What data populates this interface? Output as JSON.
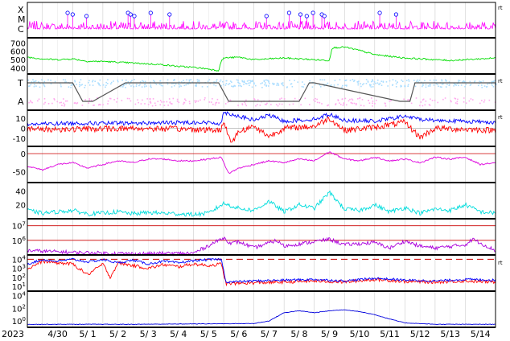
{
  "year": "2023",
  "x_axis": {
    "start": "2023-04-29T12:00",
    "end": "2023-05-15T00:00",
    "tick_labels": [
      {
        "label": "4/30",
        "date": "2023-04-30"
      },
      {
        "label": "5/ 1",
        "date": "2023-05-01"
      },
      {
        "label": "5/ 2",
        "date": "2023-05-02"
      },
      {
        "label": "5/ 3",
        "date": "2023-05-03"
      },
      {
        "label": "5/ 4",
        "date": "2023-05-04"
      },
      {
        "label": "5/ 5",
        "date": "2023-05-05"
      },
      {
        "label": "5/ 6",
        "date": "2023-05-06"
      },
      {
        "label": "5/ 7",
        "date": "2023-05-07"
      },
      {
        "label": "5/ 8",
        "date": "2023-05-08"
      },
      {
        "label": "5/ 9",
        "date": "2023-05-09"
      },
      {
        "label": "5/10",
        "date": "2023-05-10"
      },
      {
        "label": "5/11",
        "date": "2023-05-11"
      },
      {
        "label": "5/12",
        "date": "2023-05-12"
      },
      {
        "label": "5/13",
        "date": "2023-05-13"
      },
      {
        "label": "5/14",
        "date": "2023-05-14"
      }
    ]
  },
  "right_marks": [
    "rt",
    "rt",
    "rt",
    "rt"
  ],
  "colors": {
    "flare": "#ff00ff",
    "flare_marker": "#0000ff",
    "speed": "#00dd00",
    "direction": "#aaddff",
    "direction_away": "#ffaaee",
    "direction_sector": "#555555",
    "b_total": "#0000ff",
    "bz": "#ff0000",
    "dst": "#dd00dd",
    "kp": "#00dddd",
    "electron": "#aa00dd",
    "proton_hi": "#0000ff",
    "proton_lo": "#ff0000",
    "neutron": "#0000dd",
    "ref_line": "#cc0000",
    "grid": "#cccccc"
  },
  "chart_data": [
    {
      "type": "line",
      "panel": "flare",
      "ytick_labels": [
        "X",
        "M",
        "C"
      ],
      "markers": [
        "2023-04-30T20:00",
        "2023-05-01T00:00",
        "2023-05-01T11:00",
        "2023-05-02T20:00",
        "2023-05-02T22:00",
        "2023-05-03T01:00",
        "2023-05-03T14:00",
        "2023-05-04T05:00",
        "2023-05-07T10:00",
        "2023-05-08T04:00",
        "2023-05-08T13:00",
        "2023-05-08T18:00",
        "2023-05-08T23:00",
        "2023-05-09T06:00",
        "2023-05-09T08:00",
        "2023-05-11T04:00",
        "2023-05-11T17:00"
      ]
    },
    {
      "type": "line",
      "panel": "solar-wind-speed",
      "ytick_labels": [
        "700",
        "600",
        "500",
        "400"
      ],
      "ylim": [
        330,
        760
      ],
      "series": [
        {
          "x": [
            "2023-04-29T12:00",
            "2023-04-30T00:00",
            "2023-04-30T12:00",
            "2023-05-01T00:00",
            "2023-05-01T12:00",
            "2023-05-02T00:00",
            "2023-05-02T12:00",
            "2023-05-03T00:00",
            "2023-05-03T12:00",
            "2023-05-04T00:00",
            "2023-05-04T12:00",
            "2023-05-05T00:00",
            "2023-05-05T12:00",
            "2023-05-05T20:00",
            "2023-05-05T22:00",
            "2023-05-06T00:00",
            "2023-05-06T12:00",
            "2023-05-07T00:00",
            "2023-05-07T12:00",
            "2023-05-08T00:00",
            "2023-05-08T12:00",
            "2023-05-09T00:00",
            "2023-05-09T12:00",
            "2023-05-09T14:00",
            "2023-05-10T00:00",
            "2023-05-10T12:00",
            "2023-05-11T00:00",
            "2023-05-11T12:00",
            "2023-05-12T00:00",
            "2023-05-12T12:00",
            "2023-05-13T00:00",
            "2023-05-13T12:00",
            "2023-05-14T00:00",
            "2023-05-14T12:00",
            "2023-05-15T00:00"
          ],
          "values": [
            530,
            510,
            500,
            510,
            480,
            480,
            470,
            460,
            450,
            440,
            420,
            410,
            390,
            370,
            480,
            520,
            530,
            500,
            510,
            520,
            510,
            500,
            490,
            640,
            650,
            610,
            560,
            540,
            520,
            510,
            500,
            490,
            500,
            510,
            520
          ]
        }
      ]
    },
    {
      "type": "scatter",
      "panel": "imf-direction",
      "ytick_labels": [
        "T",
        "A"
      ],
      "sector_x": [
        "2023-04-29T12:00",
        "2023-05-01T00:00",
        "2023-05-01T08:00",
        "2023-05-01T16:00",
        "2023-05-02T18:00",
        "2023-05-03T04:00",
        "2023-05-05T20:00",
        "2023-05-06T04:00",
        "2023-05-08T12:00",
        "2023-05-08T20:00",
        "2023-05-09T00:00",
        "2023-05-11T20:00",
        "2023-05-12T04:00",
        "2023-05-12T08:00",
        "2023-05-15T00:00"
      ],
      "sector_values": [
        "T",
        "T",
        "A",
        "A",
        "T",
        "T",
        "T",
        "A",
        "A",
        "T",
        "T",
        "A",
        "A",
        "T",
        "T"
      ]
    },
    {
      "type": "line",
      "panel": "imf-field",
      "ytick_labels": [
        "10",
        "0",
        "-10"
      ],
      "ylim": [
        -18,
        18
      ],
      "series": [
        {
          "x": [
            "2023-04-29T12:00",
            "2023-05-01T00:00",
            "2023-05-03T00:00",
            "2023-05-05T00:00",
            "2023-05-05T22:00",
            "2023-05-06T00:00",
            "2023-05-06T12:00",
            "2023-05-07T00:00",
            "2023-05-07T12:00",
            "2023-05-08T00:00",
            "2023-05-09T00:00",
            "2023-05-09T12:00",
            "2023-05-10T00:00",
            "2023-05-11T00:00",
            "2023-05-12T00:00",
            "2023-05-12T12:00",
            "2023-05-13T00:00",
            "2023-05-14T00:00",
            "2023-05-15T00:00"
          ],
          "values": [
            4,
            5,
            5,
            6,
            5,
            16,
            12,
            8,
            13,
            7,
            9,
            14,
            8,
            7,
            12,
            9,
            8,
            7,
            6
          ]
        },
        {
          "x": [
            "2023-04-29T12:00",
            "2023-05-01T00:00",
            "2023-05-03T00:00",
            "2023-05-05T00:00",
            "2023-05-05T22:00",
            "2023-05-06T00:00",
            "2023-05-06T06:00",
            "2023-05-06T12:00",
            "2023-05-07T00:00",
            "2023-05-07T12:00",
            "2023-05-08T00:00",
            "2023-05-09T00:00",
            "2023-05-09T12:00",
            "2023-05-10T00:00",
            "2023-05-11T00:00",
            "2023-05-12T00:00",
            "2023-05-12T12:00",
            "2023-05-13T00:00",
            "2023-05-14T00:00",
            "2023-05-15T00:00"
          ],
          "values": [
            -1,
            -1,
            0,
            -1,
            -2,
            8,
            -15,
            -3,
            2,
            -8,
            0,
            2,
            10,
            -2,
            1,
            6,
            -9,
            0,
            -1,
            -2
          ]
        }
      ]
    },
    {
      "type": "line",
      "panel": "dst",
      "ytick_labels": [
        "0",
        "-50"
      ],
      "ylim": [
        -80,
        20
      ],
      "series": [
        {
          "x": [
            "2023-04-29T12:00",
            "2023-04-30T00:00",
            "2023-04-30T12:00",
            "2023-05-01T00:00",
            "2023-05-01T12:00",
            "2023-05-02T00:00",
            "2023-05-02T12:00",
            "2023-05-03T00:00",
            "2023-05-03T12:00",
            "2023-05-04T00:00",
            "2023-05-04T12:00",
            "2023-05-05T00:00",
            "2023-05-05T12:00",
            "2023-05-05T22:00",
            "2023-05-06T04:00",
            "2023-05-06T12:00",
            "2023-05-07T00:00",
            "2023-05-07T12:00",
            "2023-05-08T00:00",
            "2023-05-08T12:00",
            "2023-05-09T00:00",
            "2023-05-09T12:00",
            "2023-05-10T00:00",
            "2023-05-10T12:00",
            "2023-05-11T00:00",
            "2023-05-11T12:00",
            "2023-05-12T00:00",
            "2023-05-12T12:00",
            "2023-05-13T00:00",
            "2023-05-13T12:00",
            "2023-05-14T00:00",
            "2023-05-14T12:00",
            "2023-05-15T00:00"
          ],
          "values": [
            -35,
            -45,
            -30,
            -25,
            -40,
            -30,
            -20,
            -25,
            -15,
            -15,
            -20,
            -20,
            -15,
            -10,
            -55,
            -40,
            -30,
            -20,
            -25,
            -15,
            -20,
            5,
            -15,
            -20,
            -10,
            -20,
            -15,
            -25,
            -10,
            -15,
            -10,
            -30,
            -25
          ]
        }
      ]
    },
    {
      "type": "line",
      "panel": "kp",
      "ytick_labels": [
        "40",
        "20"
      ],
      "ylim": [
        0,
        52
      ],
      "series": [
        {
          "x": [
            "2023-04-29T12:00",
            "2023-04-30T00:00",
            "2023-04-30T12:00",
            "2023-05-01T00:00",
            "2023-05-01T12:00",
            "2023-05-02T00:00",
            "2023-05-02T12:00",
            "2023-05-03T00:00",
            "2023-05-03T12:00",
            "2023-05-04T00:00",
            "2023-05-04T12:00",
            "2023-05-05T00:00",
            "2023-05-05T12:00",
            "2023-05-06T00:00",
            "2023-05-06T12:00",
            "2023-05-07T00:00",
            "2023-05-07T12:00",
            "2023-05-08T00:00",
            "2023-05-08T12:00",
            "2023-05-09T00:00",
            "2023-05-09T12:00",
            "2023-05-10T00:00",
            "2023-05-10T12:00",
            "2023-05-11T00:00",
            "2023-05-11T12:00",
            "2023-05-12T00:00",
            "2023-05-12T12:00",
            "2023-05-13T00:00",
            "2023-05-13T12:00",
            "2023-05-14T00:00",
            "2023-05-14T12:00",
            "2023-05-15T00:00"
          ],
          "values": [
            12,
            8,
            10,
            12,
            7,
            8,
            10,
            7,
            9,
            8,
            7,
            6,
            8,
            22,
            15,
            12,
            25,
            10,
            20,
            15,
            38,
            14,
            12,
            20,
            10,
            16,
            8,
            14,
            12,
            20,
            10,
            8
          ]
        }
      ]
    },
    {
      "type": "line",
      "panel": "electron-flux",
      "ytick_labels": [
        "10^7",
        "10^6"
      ],
      "yscale": "log",
      "ylim": [
        100000,
        30000000
      ],
      "reference_lines": [
        10000000,
        1000000
      ],
      "series": [
        {
          "x": [
            "2023-04-29T12:00",
            "2023-05-01T00:00",
            "2023-05-03T00:00",
            "2023-05-05T00:00",
            "2023-05-06T00:00",
            "2023-05-06T06:00",
            "2023-05-06T12:00",
            "2023-05-07T00:00",
            "2023-05-07T18:00",
            "2023-05-08T00:00",
            "2023-05-09T00:00",
            "2023-05-09T12:00",
            "2023-05-10T00:00",
            "2023-05-11T00:00",
            "2023-05-11T12:00",
            "2023-05-12T00:00",
            "2023-05-12T12:00",
            "2023-05-13T00:00",
            "2023-05-14T00:00",
            "2023-05-14T06:00",
            "2023-05-15T00:00"
          ],
          "values": [
            200000,
            150000,
            120000,
            130000,
            1500000,
            600000,
            800000,
            300000,
            1000000,
            400000,
            800000,
            1200000,
            500000,
            700000,
            300000,
            900000,
            400000,
            300000,
            500000,
            1200000,
            200000
          ]
        }
      ]
    },
    {
      "type": "line",
      "panel": "proton-flux",
      "ytick_labels": [
        "10^4",
        "10^3",
        "10^2",
        "10^1"
      ],
      "yscale": "log",
      "ylim": [
        3,
        30000
      ],
      "reference_lines": [
        10000
      ],
      "series": [
        {
          "x": [
            "2023-04-29T12:00",
            "2023-04-30T00:00",
            "2023-04-30T12:00",
            "2023-05-01T00:00",
            "2023-05-01T12:00",
            "2023-05-02T00:00",
            "2023-05-02T12:00",
            "2023-05-03T00:00",
            "2023-05-03T12:00",
            "2023-05-04T00:00",
            "2023-05-04T12:00",
            "2023-05-05T00:00",
            "2023-05-05T12:00",
            "2023-05-05T22:00",
            "2023-05-06T02:00",
            "2023-05-07T00:00",
            "2023-05-08T00:00",
            "2023-05-09T00:00",
            "2023-05-10T00:00",
            "2023-05-11T00:00",
            "2023-05-12T00:00",
            "2023-05-13T00:00",
            "2023-05-14T00:00",
            "2023-05-15T00:00"
          ],
          "values": [
            3000,
            9000,
            6000,
            10000,
            5000,
            9000,
            4000,
            8000,
            3000,
            6000,
            4000,
            7000,
            9000,
            10000,
            30,
            40,
            50,
            60,
            40,
            80,
            50,
            40,
            60,
            50
          ]
        },
        {
          "x": [
            "2023-04-29T12:00",
            "2023-04-30T00:00",
            "2023-04-30T12:00",
            "2023-05-01T00:00",
            "2023-05-01T12:00",
            "2023-05-02T00:00",
            "2023-05-02T06:00",
            "2023-05-02T12:00",
            "2023-05-03T00:00",
            "2023-05-03T12:00",
            "2023-05-04T00:00",
            "2023-05-04T12:00",
            "2023-05-05T00:00",
            "2023-05-05T12:00",
            "2023-05-05T22:00",
            "2023-05-06T02:00",
            "2023-05-07T00:00",
            "2023-05-08T00:00",
            "2023-05-09T00:00",
            "2023-05-10T00:00",
            "2023-05-11T00:00",
            "2023-05-12T00:00",
            "2023-05-13T00:00",
            "2023-05-14T00:00",
            "2023-05-15T00:00"
          ],
          "values": [
            800,
            6000,
            4000,
            3000,
            200,
            3000,
            100,
            4000,
            2000,
            1000,
            2500,
            1500,
            3000,
            2000,
            3000,
            20,
            25,
            30,
            40,
            30,
            60,
            35,
            30,
            40,
            30
          ]
        }
      ]
    },
    {
      "type": "line",
      "panel": "neutron",
      "ytick_labels": [
        "10^4",
        "10^2",
        "10^0"
      ],
      "yscale": "log",
      "ylim": [
        0.1,
        50000
      ],
      "series": [
        {
          "x": [
            "2023-04-29T12:00",
            "2023-05-03T00:00",
            "2023-05-07T00:00",
            "2023-05-07T12:00",
            "2023-05-08T00:00",
            "2023-05-08T12:00",
            "2023-05-09T00:00",
            "2023-05-09T12:00",
            "2023-05-10T00:00",
            "2023-05-10T12:00",
            "2023-05-11T00:00",
            "2023-05-11T12:00",
            "2023-05-12T00:00",
            "2023-05-13T00:00",
            "2023-05-15T00:00"
          ],
          "values": [
            0.3,
            0.3,
            0.4,
            1,
            20,
            40,
            20,
            40,
            60,
            30,
            10,
            2,
            0.5,
            0.3,
            0.3
          ]
        }
      ]
    }
  ]
}
